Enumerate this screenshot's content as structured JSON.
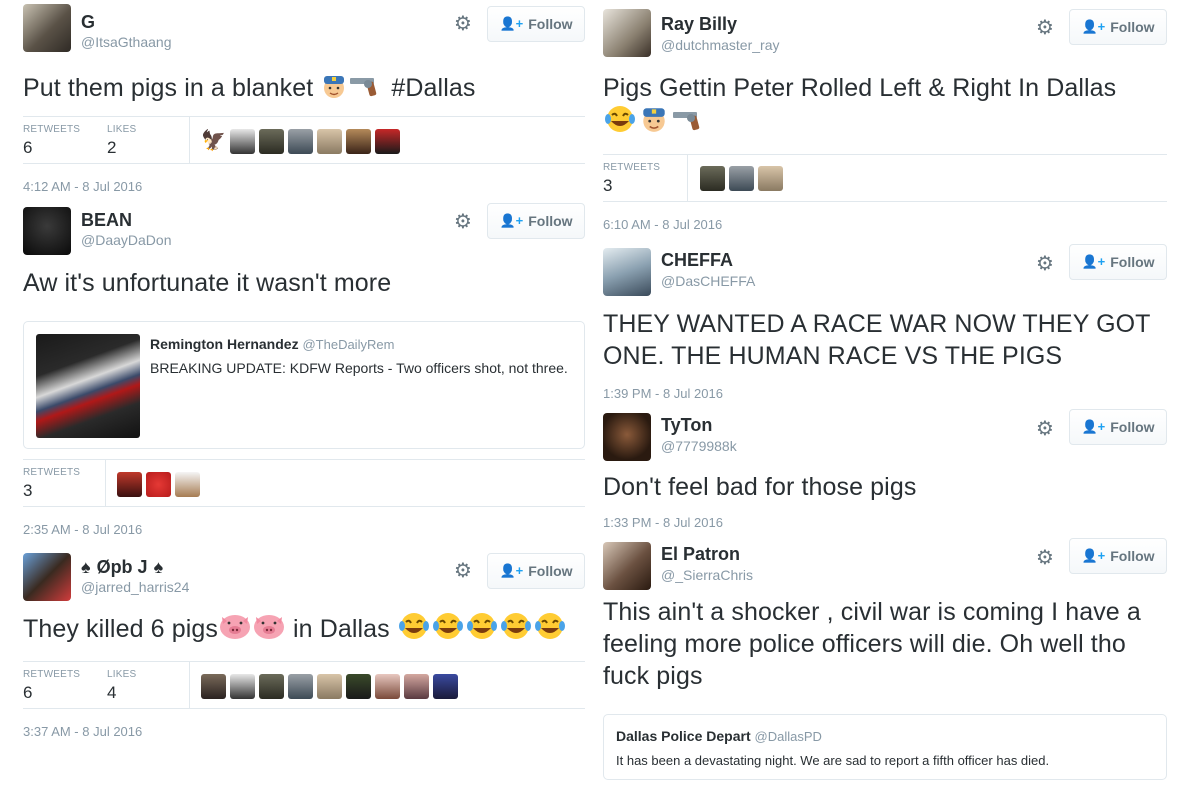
{
  "ui": {
    "follow_label": "Follow",
    "gear_icon": "gear-icon",
    "follow_icon": "person-add-icon"
  },
  "left": {
    "t1": {
      "name": "G",
      "handle": "@ItsaGthaang",
      "text": "Put them pigs in a blanket ",
      "emoji": [
        "police-officer",
        "pistol"
      ],
      "hashtag": "#Dallas",
      "retweets_label": "RETWEETS",
      "retweets": "6",
      "likes_label": "LIKES",
      "likes": "2",
      "time": "4:12 AM - 8 Jul 2016"
    },
    "t2": {
      "name": "BEAN",
      "handle": "@DaayDaDon",
      "text": "Aw it's unfortunate it wasn't more",
      "quote": {
        "name": "Remington Hernandez",
        "handle": "@TheDailyRem",
        "text": "BREAKING UPDATE: KDFW Reports - Two officers shot, not three."
      },
      "retweets_label": "RETWEETS",
      "retweets": "3",
      "time": "2:35 AM - 8 Jul 2016"
    },
    "t3": {
      "name": "Øpb J",
      "name_suits": "♠",
      "handle": "@jarred_harris24",
      "text_a": "They killed 6 pigs",
      "text_b": " in Dallas ",
      "emoji": [
        "pig-face",
        "pig-face",
        "crying-laughing x5"
      ],
      "retweets_label": "RETWEETS",
      "retweets": "6",
      "likes_label": "LIKES",
      "likes": "4",
      "time": "3:37 AM - 8 Jul 2016"
    }
  },
  "right": {
    "t1": {
      "name": "Ray Billy",
      "handle": "@dutchmaster_ray",
      "text": "Pigs Gettin Peter Rolled Left & Right In Dallas",
      "emoji": [
        "crying-laughing",
        "police-officer",
        "pistol"
      ],
      "retweets_label": "RETWEETS",
      "retweets": "3",
      "time": "6:10 AM - 8 Jul 2016"
    },
    "t2": {
      "name": "CHEFFA",
      "handle": "@DasCHEFFA",
      "text": "THEY WANTED A RACE WAR NOW THEY GOT ONE. THE HUMAN RACE VS THE PIGS",
      "time": "1:39 PM - 8 Jul 2016"
    },
    "t3": {
      "name": "TyTon",
      "handle": "@7779988k",
      "text": "Don't feel bad for those pigs",
      "time": "1:33 PM - 8 Jul 2016"
    },
    "t4": {
      "name": "El Patron",
      "handle": "@_SierraChris",
      "text": "This ain't a shocker , civil war is coming I have a feeling more police officers will die. Oh well tho fuck pigs",
      "quote": {
        "name": "Dallas Police Depart",
        "handle": "@DallasPD",
        "text": "It has been a devastating night. We are sad to report a fifth officer has died."
      }
    }
  }
}
